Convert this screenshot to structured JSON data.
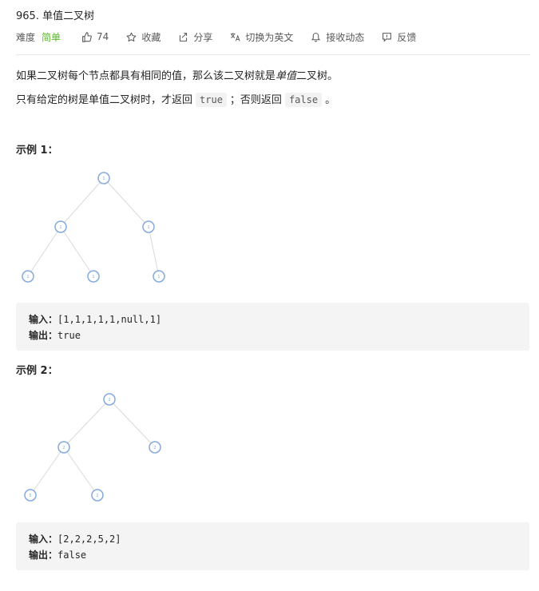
{
  "problem": {
    "title": "965. 单值二叉树"
  },
  "meta": {
    "difficulty_label": "难度",
    "difficulty_value": "简单",
    "likes": "74",
    "favorite": "收藏",
    "share": "分享",
    "switch_lang": "切换为英文",
    "notifications": "接收动态",
    "feedback": "反馈"
  },
  "description": {
    "p1_prefix": "如果二叉树每个节点都具有相同的值，那么该二叉树就是",
    "p1_em": "单值",
    "p1_suffix": "二叉树。",
    "p2_prefix": "只有给定的树是单值二叉树时，才返回",
    "p2_true": "true",
    "p2_mid": "；否则返回",
    "p2_false": "false",
    "p2_suffix": "。"
  },
  "examples": [
    {
      "title": "示例 1：",
      "tree_values": [
        "1",
        "1",
        "1",
        "1",
        "1",
        "1"
      ],
      "input_label": "输入：",
      "input_value": "[1,1,1,1,1,null,1]",
      "output_label": "输出：",
      "output_value": "true"
    },
    {
      "title": "示例 2：",
      "tree_values": [
        "2",
        "2",
        "2",
        "5",
        "2"
      ],
      "input_label": "输入：",
      "input_value": "[2,2,2,5,2]",
      "output_label": "输出：",
      "output_value": "false"
    }
  ],
  "colors": {
    "difficulty_easy": "#5ab726",
    "node_stroke": "#84aadc"
  },
  "icons": [
    "thumbs-up-icon",
    "star-icon",
    "share-icon",
    "translate-icon",
    "bell-icon",
    "feedback-icon"
  ]
}
